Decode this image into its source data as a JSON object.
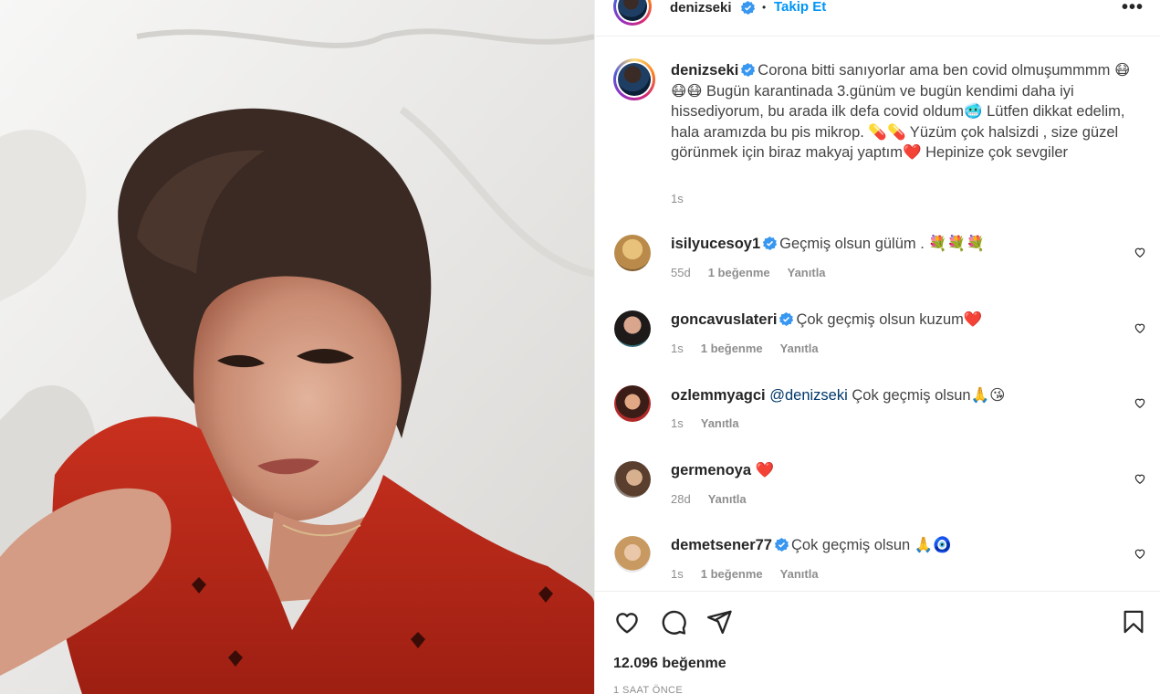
{
  "header": {
    "username": "denizseki",
    "separator": "•",
    "follow_label": "Takip Et",
    "more_label": "•••"
  },
  "caption": {
    "username": "denizseki",
    "text": "Corona bitti sanıyorlar ama ben covid olmuşummmm 😷😷😷 Bugün karantinada 3.günüm ve bugün kendimi daha iyi hissediyorum, bu arada ilk defa covid oldum🥶 Lütfen dikkat edelim, hala aramızda bu pis mikrop. 💊💊 Yüzüm çok halsizdi , size güzel görünmek için biraz makyaj yaptım❤️  Hepinize çok sevgiler",
    "time": "1s"
  },
  "comments": [
    {
      "username": "isilyucesoy1",
      "verified": true,
      "text": "Geçmiş olsun gülüm . 💐💐💐",
      "time": "55d",
      "likes": "1 beğenme",
      "reply": "Yanıtla"
    },
    {
      "username": "goncavuslateri",
      "verified": true,
      "text": "Çok geçmiş olsun kuzum❤️",
      "time": "1s",
      "likes": "1 beğenme",
      "reply": "Yanıtla"
    },
    {
      "username": "ozlemmyagci",
      "verified": false,
      "mention": "@denizseki",
      "text": "Çok geçmiş olsun🙏😘",
      "time": "1s",
      "reply": "Yanıtla"
    },
    {
      "username": "germenoya",
      "verified": false,
      "text": "❤️",
      "time": "28d",
      "reply": "Yanıtla"
    },
    {
      "username": "demetsener77",
      "verified": true,
      "text": "Çok geçmiş olsun 🙏🧿",
      "time": "1s",
      "likes": "1 beğenme",
      "reply": "Yanıtla"
    }
  ],
  "actions": {
    "icons": [
      "heart-icon",
      "comment-icon",
      "share-icon",
      "bookmark-icon"
    ],
    "likes_count": "12.096 beğenme",
    "posted": "1 SAAT ÖNCE"
  },
  "colors": {
    "link": "#0095f6",
    "verified": "#3897f0",
    "secondary_text": "#8e8e8e"
  }
}
